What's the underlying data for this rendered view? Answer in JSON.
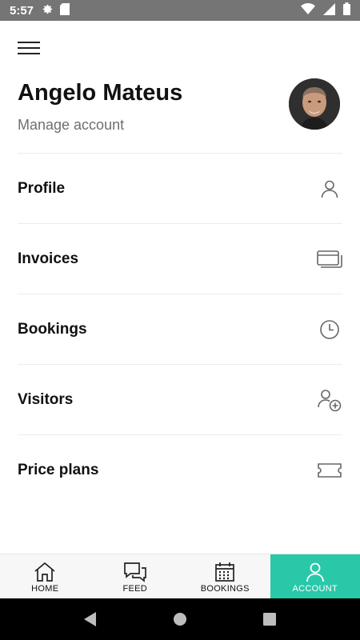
{
  "status_bar": {
    "time": "5:57",
    "left_icons": [
      "gear-icon",
      "sd-card-icon"
    ],
    "right_icons": [
      "wifi-icon",
      "signal-icon",
      "battery-icon"
    ]
  },
  "header": {
    "menu_icon": "hamburger-icon",
    "user_name": "Angelo Mateus",
    "subtitle": "Manage account",
    "avatar": "profile-photo"
  },
  "menu": {
    "items": [
      {
        "label": "Profile",
        "icon": "person-icon"
      },
      {
        "label": "Invoices",
        "icon": "cards-icon"
      },
      {
        "label": "Bookings",
        "icon": "clock-icon"
      },
      {
        "label": "Visitors",
        "icon": "add-person-icon"
      },
      {
        "label": "Price plans",
        "icon": "ticket-icon"
      }
    ]
  },
  "bottom_nav": {
    "items": [
      {
        "label": "HOME",
        "icon": "home-icon"
      },
      {
        "label": "FEED",
        "icon": "chat-icon"
      },
      {
        "label": "BOOKINGS",
        "icon": "calendar-icon"
      },
      {
        "label": "ACCOUNT",
        "icon": "person-icon",
        "active": true
      }
    ],
    "active_color": "#29c8a9"
  },
  "system_nav": [
    "back-icon",
    "home-circle-icon",
    "recents-icon"
  ]
}
